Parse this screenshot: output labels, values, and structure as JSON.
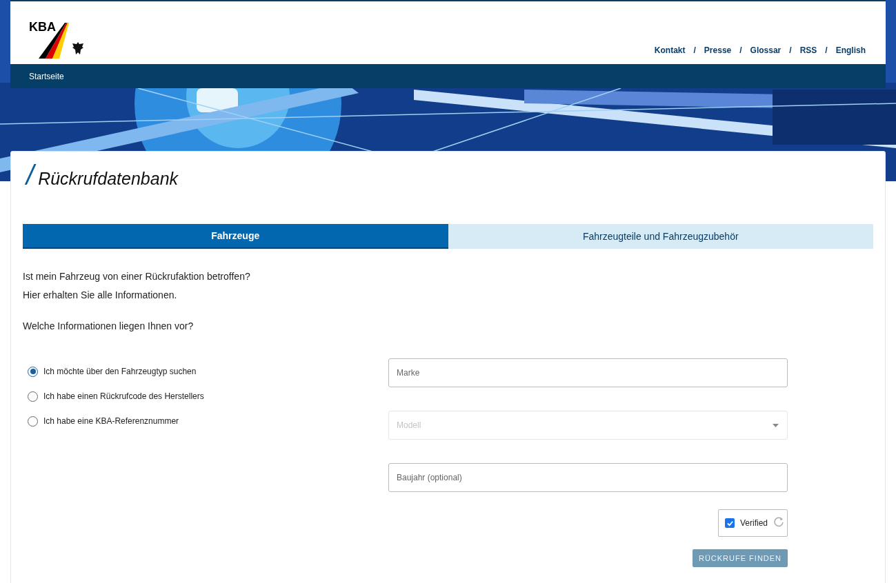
{
  "logo": {
    "text": "KBA"
  },
  "top_links": [
    "Kontakt",
    "Presse",
    "Glossar",
    "RSS",
    "English"
  ],
  "top_link_separator": "/",
  "nav": [
    {
      "label": "Startseite",
      "selected": false
    }
  ],
  "hero": {
    "kind": "picture"
  },
  "page_title": "Rückrufdatenbank",
  "title_mark": "/",
  "tabs": [
    {
      "label": "Fahrzeuge",
      "selected": true
    },
    {
      "label": "Fahrzeugteile und Fahrzeugzubehör",
      "selected": false
    }
  ],
  "intro": [
    "Ist mein Fahrzeug von einer Rückrufaktion betroffen?",
    "Hier erhalten Sie alle Informationen."
  ],
  "question": "Welche Informationen liegen Ihnen vor?",
  "options": [
    {
      "label": "Ich möchte über den Fahrzeugtyp suchen",
      "selected": true
    },
    {
      "label": "Ich habe einen Rückrufcode des Herstellers",
      "selected": false
    },
    {
      "label": "Ich habe eine KBA-Referenznummer",
      "selected": false
    }
  ],
  "fields": [
    {
      "kind": "text",
      "placeholder": "Marke",
      "disabled": false
    },
    {
      "kind": "select",
      "placeholder": "Modell",
      "disabled": true
    },
    {
      "kind": "text",
      "placeholder": "Baujahr (optional)",
      "disabled": false
    }
  ],
  "captcha": {
    "label": "Verified",
    "checked": true
  },
  "submit": {
    "label": "RÜCKRUFE FINDEN",
    "disabled": true
  }
}
